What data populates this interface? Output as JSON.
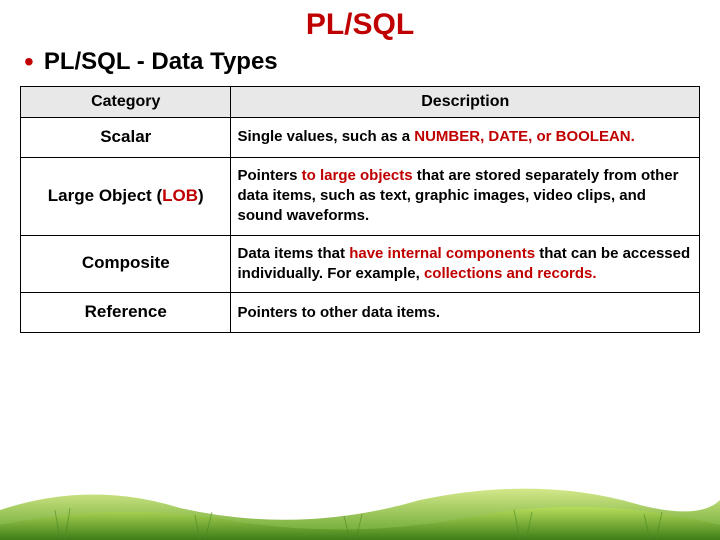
{
  "title": "PL/SQL",
  "subtitle": "PL/SQL - Data Types",
  "headers": {
    "category": "Category",
    "description": "Description"
  },
  "rows": [
    {
      "category_pre": "Scalar",
      "category_red": "",
      "category_post": "",
      "desc_pre": "Single values, such as a ",
      "desc_red": "NUMBER, DATE, or BOOLEAN.",
      "desc_post": ""
    },
    {
      "category_pre": "Large Object (",
      "category_red": "LOB",
      "category_post": ")",
      "desc_pre": "Pointers ",
      "desc_red": "to large objects",
      "desc_post": " that are stored separately from other data items, such as text, graphic images, video clips, and sound waveforms."
    },
    {
      "category_pre": "Composite",
      "category_red": "",
      "category_post": "",
      "desc_pre": "Data items that ",
      "desc_red": "have internal components",
      "desc_post": " that can be accessed individually. For example, ",
      "desc_red2": "collections and records.",
      "desc_post2": ""
    },
    {
      "category_pre": "Reference",
      "category_red": "",
      "category_post": "",
      "desc_pre": "Pointers to other data items.",
      "desc_red": "",
      "desc_post": ""
    }
  ]
}
